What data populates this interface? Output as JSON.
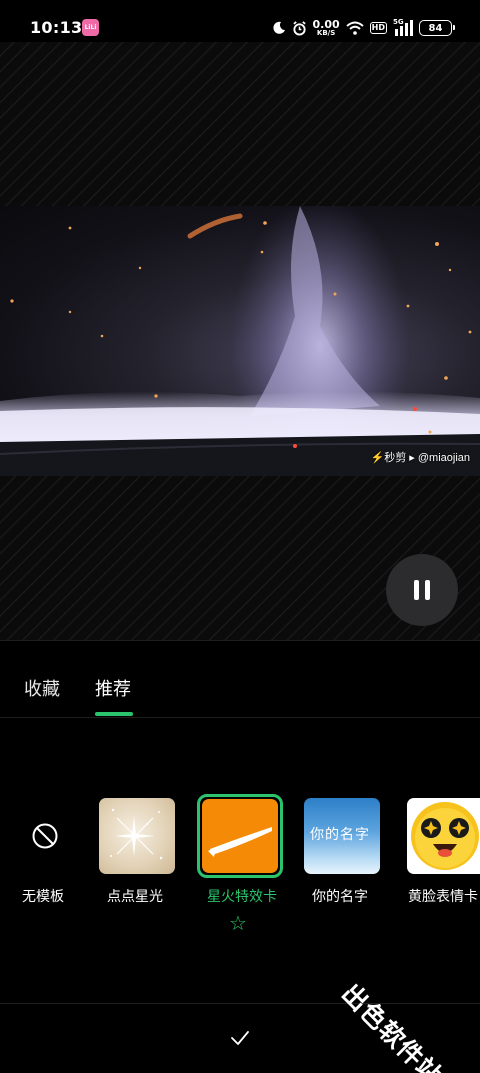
{
  "status_bar": {
    "time": "10:13",
    "app_badge": "LiLi",
    "net_speed_value": "0.00",
    "net_speed_unit": "KB/S",
    "hd_label": "HD",
    "signal_label": "5G",
    "battery": "84"
  },
  "preview": {
    "watermark": "⚡秒剪 ▸ @miaojian",
    "accent_color": "#2bc36b"
  },
  "tabs": [
    {
      "label": "收藏",
      "active": false
    },
    {
      "label": "推荐",
      "active": true
    }
  ],
  "templates": [
    {
      "label": "无模板",
      "icon": "no-symbol-icon"
    },
    {
      "label": "点点星光",
      "thumb": "sparkle"
    },
    {
      "label": "星火特效卡",
      "thumb": "orange-streak",
      "selected": true
    },
    {
      "label": "你的名字",
      "thumb": "sky",
      "thumb_text": "你的名字"
    },
    {
      "label": "黄脸表情卡",
      "thumb": "emoji-face"
    }
  ],
  "favorite_icon": "star-outline-icon",
  "corner_mark": "出色软件站",
  "confirm_icon": "check-icon"
}
